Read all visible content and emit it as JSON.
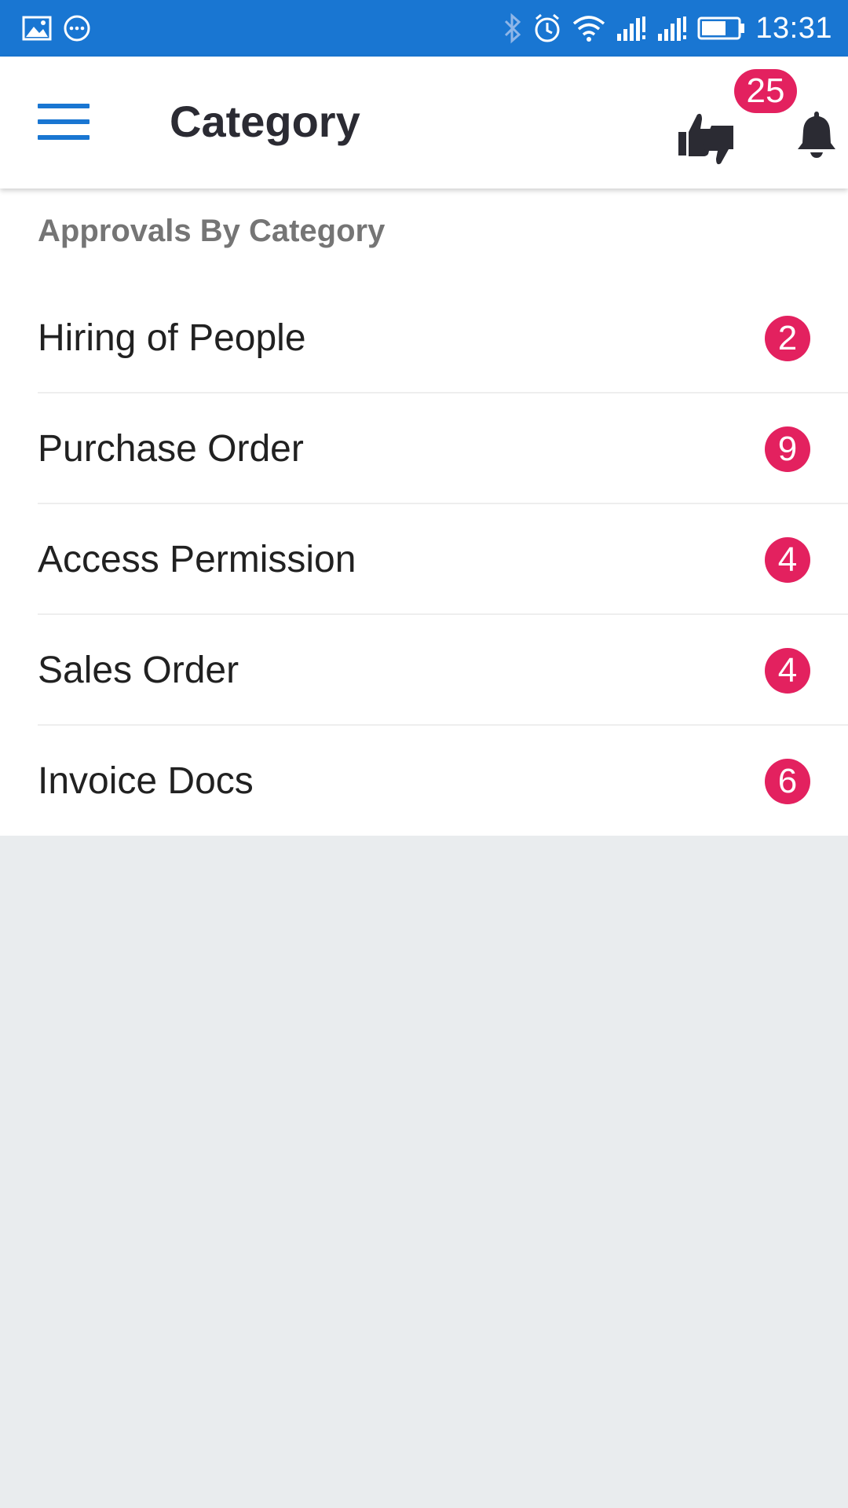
{
  "status_bar": {
    "time": "13:31",
    "left_icons": [
      "image-icon",
      "chat-icon"
    ],
    "right_icons": [
      "bluetooth-icon",
      "alarm-icon",
      "wifi-icon",
      "signal-icon",
      "signal-icon",
      "battery-icon"
    ]
  },
  "app_bar": {
    "title": "Category",
    "menu_icon": "hamburger-icon",
    "action_icon": "thumbs-up-down-icon",
    "notification_icon": "bell-icon",
    "badge_count": "25"
  },
  "section": {
    "heading": "Approvals By Category"
  },
  "categories": [
    {
      "label": "Hiring of People",
      "count": "2"
    },
    {
      "label": "Purchase Order",
      "count": "9"
    },
    {
      "label": "Access Permission",
      "count": "4"
    },
    {
      "label": "Sales Order",
      "count": "4"
    },
    {
      "label": "Invoice Docs",
      "count": "6"
    }
  ],
  "colors": {
    "status_bar": "#1976d2",
    "accent": "#1976d2",
    "badge": "#e3215f",
    "background": "#e9ecee"
  }
}
